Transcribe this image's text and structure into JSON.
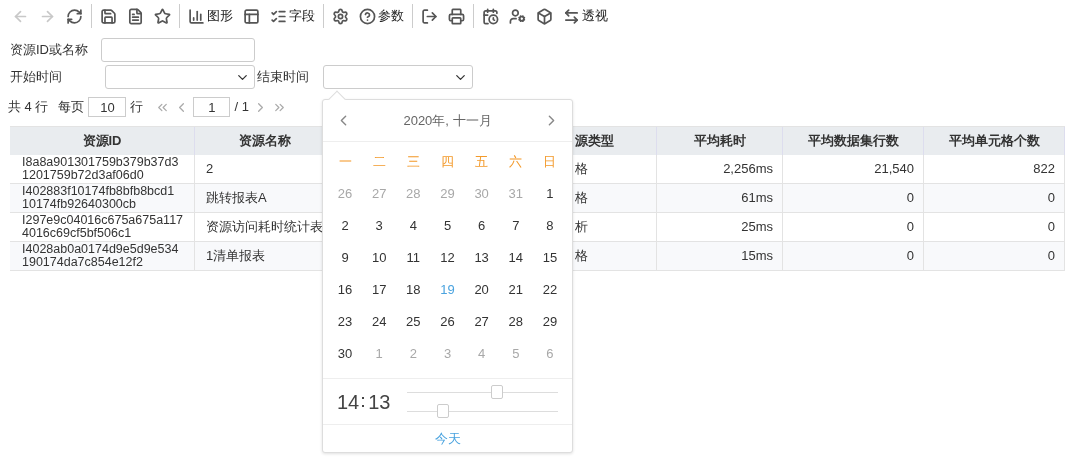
{
  "toolbar": {
    "groups": [
      [
        {
          "disabled": true
        },
        {
          "disabled": true
        },
        {
          "disabled": false
        }
      ],
      [
        {
          "disabled": false
        },
        {
          "disabled": false
        },
        {
          "disabled": false
        }
      ],
      [
        {
          "label": "图形",
          "disabled": false
        },
        {
          "disabled": false
        },
        {
          "label": "字段",
          "disabled": false
        }
      ],
      [
        {
          "disabled": false
        },
        {
          "label": "参数",
          "disabled": false
        }
      ],
      [
        {
          "disabled": false
        },
        {
          "disabled": false
        }
      ],
      [
        {
          "disabled": false
        },
        {
          "disabled": false
        },
        {
          "disabled": false
        },
        {
          "label": "透视",
          "disabled": false
        }
      ]
    ]
  },
  "filters": {
    "search_label": "资源ID或名称",
    "start_label": "开始时间",
    "end_label": "结束时间"
  },
  "pager": {
    "total": "共 4 行",
    "per_page_label": "每页",
    "per_page": "10",
    "rows_unit": "行",
    "page": "1",
    "of_pages": "/ 1"
  },
  "table": {
    "columns": [
      "资源ID",
      "资源名称",
      "源类型",
      "平均耗时",
      "平均数据集行数",
      "平均单元格个数"
    ],
    "rows": [
      [
        "I8a8a901301759b379b37d3 1201759b72d3af06d0",
        "2",
        "格",
        "2,256ms",
        "21,540",
        "822"
      ],
      [
        "I402883f10174fb8bfb8bcd1 10174fb92640300cb",
        "跳转报表A",
        "格",
        "61ms",
        "0",
        "0"
      ],
      [
        "I297e9c04016c675a675a117 4016c69cf5bf506c1",
        "资源访问耗时统计表",
        "析",
        "25ms",
        "0",
        "0"
      ],
      [
        "I4028ab0a0174d9e5d9e534 190174da7c854e12f2",
        "1清单报表",
        "格",
        "15ms",
        "0",
        "0"
      ]
    ]
  },
  "calendar": {
    "title": "2020年, 十一月",
    "weekdays": [
      "一",
      "二",
      "三",
      "四",
      "五",
      "六",
      "日"
    ],
    "weeks": [
      [
        {
          "t": "26",
          "kind": "other"
        },
        {
          "t": "27",
          "kind": "other"
        },
        {
          "t": "28",
          "kind": "other"
        },
        {
          "t": "29",
          "kind": "other"
        },
        {
          "t": "30",
          "kind": "other"
        },
        {
          "t": "31",
          "kind": "other"
        },
        {
          "t": "1",
          "kind": "current"
        }
      ],
      [
        {
          "t": "2",
          "kind": "current"
        },
        {
          "t": "3",
          "kind": "current"
        },
        {
          "t": "4",
          "kind": "current"
        },
        {
          "t": "5",
          "kind": "current"
        },
        {
          "t": "6",
          "kind": "current"
        },
        {
          "t": "7",
          "kind": "current"
        },
        {
          "t": "8",
          "kind": "current"
        }
      ],
      [
        {
          "t": "9",
          "kind": "current"
        },
        {
          "t": "10",
          "kind": "current"
        },
        {
          "t": "11",
          "kind": "current"
        },
        {
          "t": "12",
          "kind": "current"
        },
        {
          "t": "13",
          "kind": "current"
        },
        {
          "t": "14",
          "kind": "current"
        },
        {
          "t": "15",
          "kind": "current"
        }
      ],
      [
        {
          "t": "16",
          "kind": "current"
        },
        {
          "t": "17",
          "kind": "current"
        },
        {
          "t": "18",
          "kind": "current"
        },
        {
          "t": "19",
          "kind": "today"
        },
        {
          "t": "20",
          "kind": "current"
        },
        {
          "t": "21",
          "kind": "current"
        },
        {
          "t": "22",
          "kind": "current"
        }
      ],
      [
        {
          "t": "23",
          "kind": "current"
        },
        {
          "t": "24",
          "kind": "current"
        },
        {
          "t": "25",
          "kind": "current"
        },
        {
          "t": "26",
          "kind": "current"
        },
        {
          "t": "27",
          "kind": "current"
        },
        {
          "t": "28",
          "kind": "current"
        },
        {
          "t": "29",
          "kind": "current"
        }
      ],
      [
        {
          "t": "30",
          "kind": "current"
        },
        {
          "t": "1",
          "kind": "other"
        },
        {
          "t": "2",
          "kind": "other"
        },
        {
          "t": "3",
          "kind": "other"
        },
        {
          "t": "4",
          "kind": "other"
        },
        {
          "t": "5",
          "kind": "other"
        },
        {
          "t": "6",
          "kind": "other"
        }
      ]
    ],
    "hour": "14",
    "minute": "13",
    "hour_slider": {
      "level": 0.6
    },
    "minute_slider": {
      "level": 0.24
    },
    "today_label": "今天"
  }
}
